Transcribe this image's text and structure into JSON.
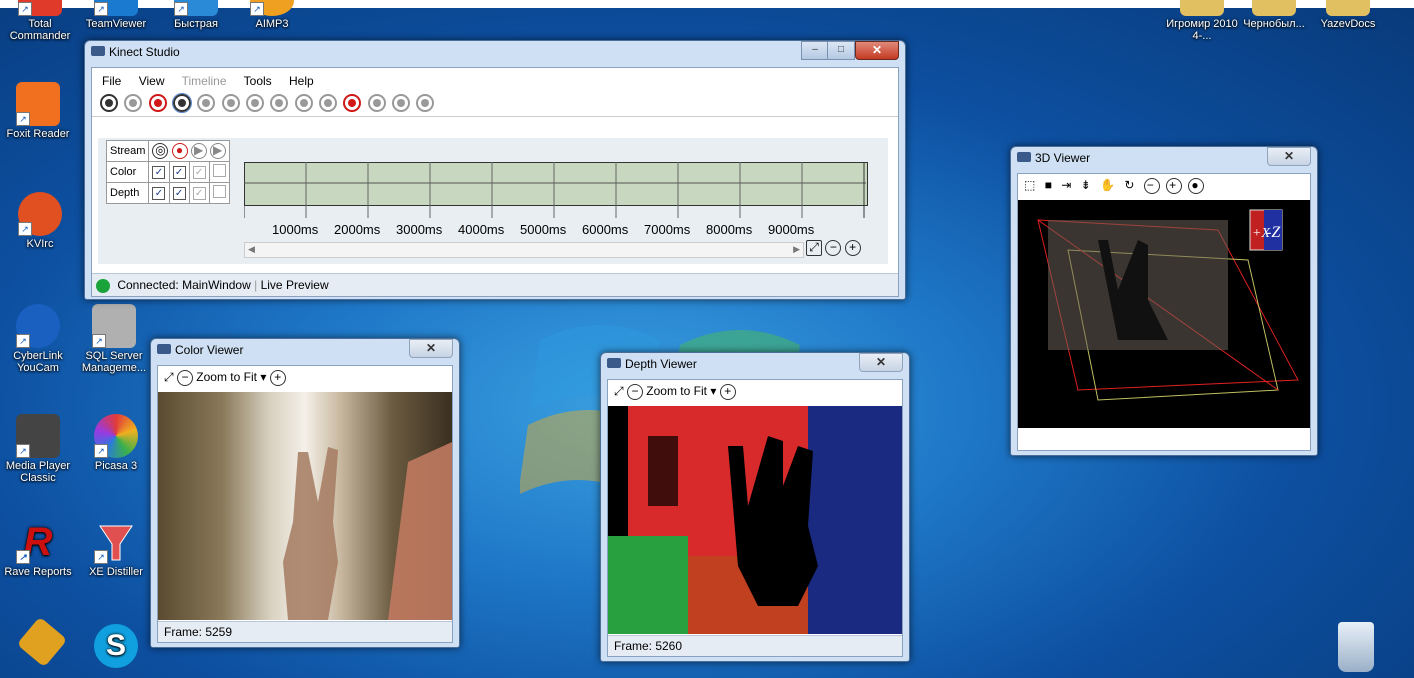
{
  "desktop": {
    "left_icons": [
      {
        "label": "Total Commander",
        "color": "#e03a2a"
      },
      {
        "label": "TeamViewer",
        "color": "#1a7ad0"
      },
      {
        "label": "Быстрая",
        "color": "#2a8ad8"
      },
      {
        "label": "AIMP3",
        "color": "#f0a020"
      },
      {
        "label": "Foxit Reader",
        "color": "#f07020"
      },
      {
        "label": "KVIrc",
        "color": "#e05020"
      },
      {
        "label": "CyberLink YouCam",
        "color": "#1a60c0"
      },
      {
        "label": "SQL Server Manageme...",
        "color": "#b0b0b0"
      },
      {
        "label": "Media Player Classic",
        "color": "#444444"
      },
      {
        "label": "Picasa 3",
        "color": "#e03a8a"
      },
      {
        "label": "Rave Reports",
        "color": "#cc1010"
      },
      {
        "label": "XE Distiller",
        "color": "#e05050"
      },
      {
        "label": "",
        "color": "#e0a020"
      },
      {
        "label": "",
        "color": "#10a0e0"
      }
    ],
    "right_icons": [
      {
        "label": "Игромир 2010 4-...",
        "color": "#e0c060"
      },
      {
        "label": "Чернобыл...",
        "color": "#e0c060"
      },
      {
        "label": "YazevDocs",
        "color": "#e0c060"
      }
    ],
    "recycle_bin": "recycle-bin-icon"
  },
  "kinect_studio": {
    "title": "Kinect Studio",
    "menu": [
      "File",
      "View",
      "Timeline",
      "Tools",
      "Help"
    ],
    "stream_header": "Stream",
    "rows": [
      "Color",
      "Depth"
    ],
    "timeline_ticks": [
      "1000ms",
      "2000ms",
      "3000ms",
      "4000ms",
      "5000ms",
      "6000ms",
      "7000ms",
      "8000ms",
      "9000ms"
    ],
    "status_connected": "Connected:",
    "status_window": "MainWindow",
    "status_mode": "Live Preview"
  },
  "color_viewer": {
    "title": "Color Viewer",
    "zoom_label": "Zoom to Fit",
    "frame": "Frame: 5259"
  },
  "depth_viewer": {
    "title": "Depth Viewer",
    "zoom_label": "Zoom to Fit",
    "frame": "Frame: 5260"
  },
  "viewer_3d": {
    "title": "3D Viewer",
    "cube_label": "-Z",
    "cube_label_side": "+X"
  },
  "colors": {
    "accent": "#1f78c8",
    "close_red": "#c43a22",
    "record_red": "#d01818",
    "connected_green": "#1aa33a"
  }
}
